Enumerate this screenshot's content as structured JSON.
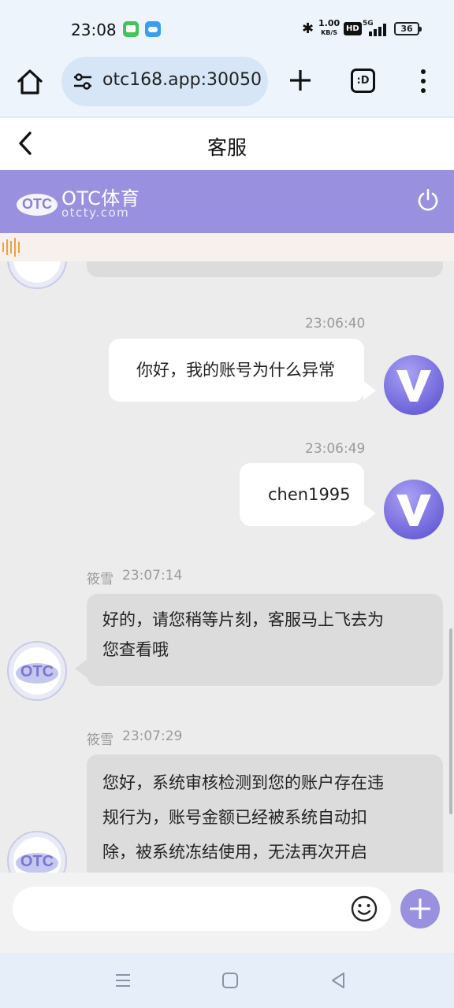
{
  "status_bar": {
    "time": "23:08",
    "net_speed_value": "1.00",
    "net_speed_unit": "KB/S",
    "hd_label": "HD",
    "signal_label": "5G",
    "battery": "36"
  },
  "browser": {
    "url": "otc168.app:30050",
    "tabs_label": ":D"
  },
  "page": {
    "title": "客服"
  },
  "brand": {
    "name": "OTC体育",
    "url": "otcty.com",
    "logo_text": "OTC",
    "accent_color": "#9a90e0"
  },
  "messages": [
    {
      "sender": "me",
      "time": "23:06:40",
      "text": "你好，我的账号为什么异常"
    },
    {
      "sender": "me",
      "time": "23:06:49",
      "text": "chen1995"
    },
    {
      "sender": "agent",
      "name": "筱雪",
      "time": "23:07:14",
      "lines": [
        "好的，请您稍等片刻，客服马上飞去为",
        "您查看哦"
      ]
    },
    {
      "sender": "agent",
      "name": "筱雪",
      "time": "23:07:29",
      "lines": [
        "您好，系统审核检测到您的账户存在违",
        "规行为，账号金额已经被系统自动扣",
        "除，被系统冻结使用，无法再次开启"
      ]
    }
  ],
  "composer": {
    "placeholder": "",
    "value": ""
  },
  "icons": {
    "home": "home-icon",
    "site_settings": "tune-icon",
    "new_tab": "plus-icon",
    "tabs": "tab-switcher-icon",
    "menu": "more-vert-icon",
    "back": "chevron-left-icon",
    "power": "power-icon",
    "emoji": "emoji-icon",
    "add": "plus-icon"
  }
}
